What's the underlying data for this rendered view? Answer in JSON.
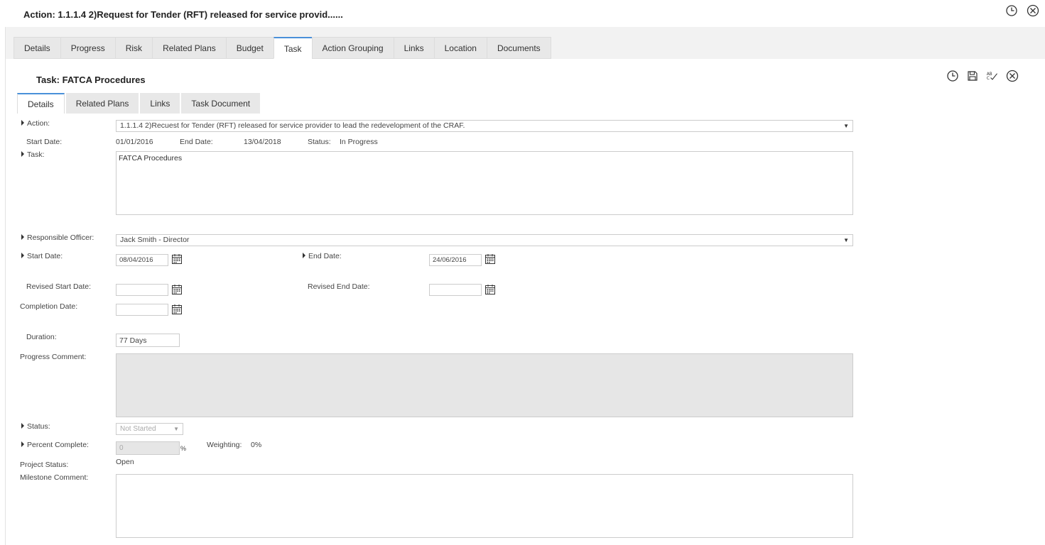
{
  "header": {
    "title": "Action: 1.1.1.4 2)Request for Tender (RFT) released for service provid......"
  },
  "outer_tabs": [
    {
      "label": "Details"
    },
    {
      "label": "Progress"
    },
    {
      "label": "Risk"
    },
    {
      "label": "Related Plans"
    },
    {
      "label": "Budget"
    },
    {
      "label": "Task"
    },
    {
      "label": "Action Grouping"
    },
    {
      "label": "Links"
    },
    {
      "label": "Location"
    },
    {
      "label": "Documents"
    }
  ],
  "task": {
    "title": "Task: FATCA Procedures",
    "spellcheck_label": "AB\nC"
  },
  "inner_tabs": [
    {
      "label": "Details"
    },
    {
      "label": "Related Plans"
    },
    {
      "label": "Links"
    },
    {
      "label": "Task Document"
    }
  ],
  "form": {
    "action_label": "Action:",
    "action_value": "1.1.1.4 2)Recuest for Tender (RFT) released for service provider to lead the redevelopment of the CRAF.",
    "start_date_label": "Start Date:",
    "start_date_value": "01/01/2016",
    "end_date_label": "End Date:",
    "end_date_value": "13/04/2018",
    "status_label": "Status:",
    "status_value": "In Progress",
    "task_label": "Task:",
    "task_value": "FATCA Procedures",
    "responsible_label": "Responsible Officer:",
    "responsible_value": "Jack Smith - Director",
    "task_start_label": "Start Date:",
    "task_start_value": "08/04/2016",
    "task_end_label": "End Date:",
    "task_end_value": "24/06/2016",
    "revised_start_label": "Revised Start Date:",
    "revised_start_value": "",
    "revised_end_label": "Revised End Date:",
    "revised_end_value": "",
    "completion_label": "Completion Date:",
    "completion_value": "",
    "duration_label": "Duration:",
    "duration_value": "77 Days",
    "progress_comment_label": "Progress Comment:",
    "progress_comment_value": "",
    "task_status_label": "Status:",
    "task_status_value": "Not Started",
    "percent_label": "Percent Complete:",
    "percent_value": "0",
    "percent_unit": "%",
    "weighting_label": "Weighting:",
    "weighting_value": "0%",
    "project_status_label": "Project Status:",
    "project_status_value": "Open",
    "milestone_label": "Milestone Comment:",
    "milestone_value": ""
  },
  "colors": {
    "active_tab_accent": "#4a90d9",
    "tab_bg": "#e8e8e8",
    "disabled_bg": "#e6e6e6"
  }
}
